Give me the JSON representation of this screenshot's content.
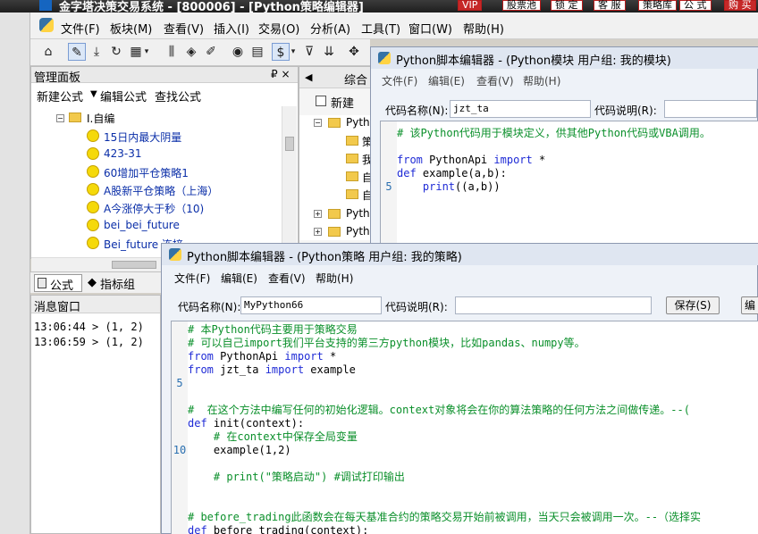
{
  "app": {
    "title": "金字塔决策交易系统 - [800006] - [Python策略编辑器]",
    "header_buttons": [
      "VIP",
      "股票池",
      "锁 定",
      "客 服",
      "策略库",
      "公 式",
      "购 买"
    ],
    "accent": "#c62828"
  },
  "menubar": [
    "文件(F)",
    "板块(M)",
    "查看(V)",
    "插入(I)",
    "交易(O)",
    "分析(A)",
    "工具(T)",
    "窗口(W)",
    "帮助(H)"
  ],
  "toolbar_icons": [
    "home-icon",
    "pencil-icon",
    "download-icon",
    "refresh-icon",
    "grid-icon",
    "chevron-down-icon",
    "bar-chart-icon",
    "diamond-icon",
    "edit-icon",
    "circle-play-icon",
    "document-icon",
    "dollar-icon",
    "chevron-down-icon",
    "filter-icon",
    "import-icon",
    "move-icon"
  ],
  "mgmt": {
    "title": "管理面板",
    "pin": "₽ ×",
    "actions": [
      "新建公式",
      "编辑公式",
      "查找公式"
    ],
    "group": "I.自编",
    "items": [
      "15日内最大阴量",
      "423-31",
      "60增加平仓策略1",
      "A股新平仓策略（上海）",
      "A今涨停大于秒（10)",
      "bei_bei_future",
      "Bei_future 连接"
    ]
  },
  "left_tabs": [
    "公式",
    "指标组"
  ],
  "msg": {
    "title": "消息窗口",
    "lines": [
      "13:06:44 > (1, 2)",
      "13:06:59 > (1, 2)"
    ]
  },
  "mid": {
    "tab": "综合",
    "new_btn": "新建",
    "folders": [
      "Pytho",
      "策",
      "我",
      "自",
      "自",
      "Pytho",
      "Pytho"
    ]
  },
  "module_editor": {
    "title": "Python脚本编辑器 - (Python模块 用户组: 我的模块)",
    "menu": [
      "文件(F)",
      "编辑(E)",
      "查看(V)",
      "帮助(H)"
    ],
    "name_label": "代码名称(N):",
    "name_value": "jzt_ta",
    "desc_label": "代码说明(R):",
    "code": {
      "comment": "# 该Python代码用于模块定义，供其他Python代码或VBA调用。",
      "l2_from": "from",
      "l2_mod": " PythonApi ",
      "l2_import": "import",
      "l2_rest": " *",
      "l3_def": "def",
      "l3_rest": " example(a,b):",
      "l4_ln": "5",
      "l4_print": "print",
      "l4_rest": "((a,b))"
    }
  },
  "strategy_editor": {
    "title": "Python脚本编辑器 - (Python策略 用户组: 我的策略)",
    "menu": [
      "文件(F)",
      "编辑(E)",
      "查看(V)",
      "帮助(H)"
    ],
    "name_label": "代码名称(N):",
    "name_value": "MyPython66",
    "desc_label": "代码说明(R):",
    "save_button": "保存(S)",
    "edit_button": "编",
    "code": {
      "c1": "# 本Python代码主要用于策略交易",
      "c2": "# 可以自己import我们平台支持的第三方python模块，比如pandas、numpy等。",
      "l3_from": "from",
      "l3_rest": " PythonApi ",
      "l3_import": "import",
      "l3_star": " *",
      "l4_from": "from",
      "l4_rest": " jzt_ta ",
      "l4_import": "import",
      "l4_star": " example",
      "ln5": "5",
      "c6": "#  在这个方法中编写任何的初始化逻辑。context对象将会在你的算法策略的任何方法之间做传递。--(",
      "l7_def": "def",
      "l7_rest": " init(context):",
      "c8": "    # 在context中保存全局变量",
      "ln10": "10",
      "l9": "    example(1,2)",
      "c11": "    # print(\"策略启动\") #调试打印输出",
      "c12": "# before_trading此函数会在每天基准合约的策略交易开始前被调用，当天只会被调用一次。--（选择实",
      "l13_def": "def",
      "l13_rest": " before_trading(context):"
    }
  }
}
